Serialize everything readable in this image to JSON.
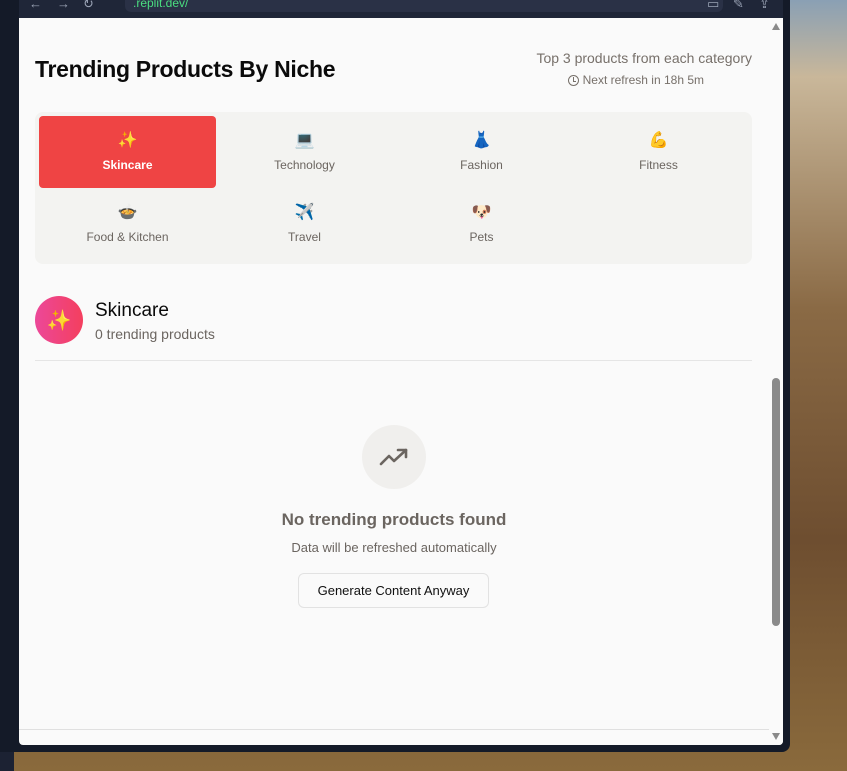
{
  "browser": {
    "url": ".replit.dev/"
  },
  "header": {
    "title": "Trending Products By Niche",
    "subtitle": "Top 3 products from each category",
    "refresh": "Next refresh in 18h 5m"
  },
  "categories": [
    {
      "label": "Skincare",
      "emoji": "✨",
      "active": true
    },
    {
      "label": "Technology",
      "emoji": "💻"
    },
    {
      "label": "Fashion",
      "emoji": "👗"
    },
    {
      "label": "Fitness",
      "emoji": "💪"
    },
    {
      "label": "Food & Kitchen",
      "emoji": "🍲"
    },
    {
      "label": "Travel",
      "emoji": "✈️"
    },
    {
      "label": "Pets",
      "emoji": "🐶"
    }
  ],
  "section": {
    "emoji": "✨",
    "title": "Skincare",
    "count": "0 trending products"
  },
  "empty": {
    "title": "No trending products found",
    "subtitle": "Data will be refreshed automatically",
    "button": "Generate Content Anyway"
  },
  "colors": {
    "accent": "#ef4444"
  }
}
